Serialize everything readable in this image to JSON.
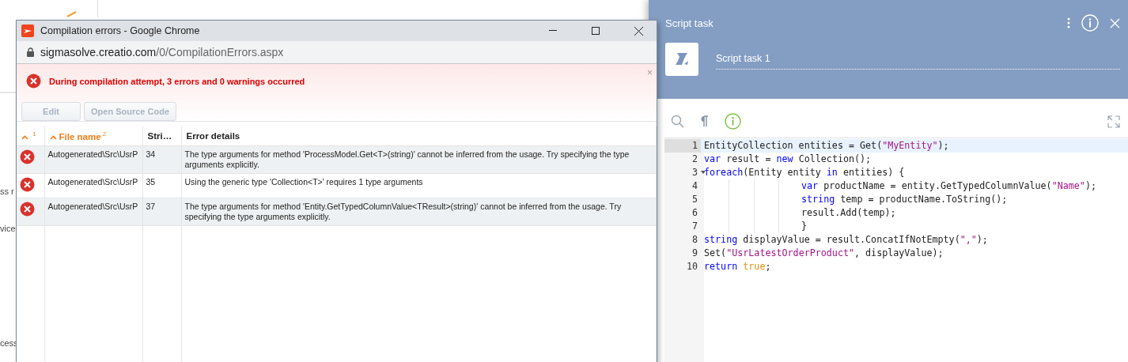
{
  "background_page": {
    "fragments": [
      "ss r",
      "vice",
      "cess"
    ]
  },
  "chrome_window": {
    "title": "Compilation errors - Google Chrome",
    "address": {
      "host": "sigmasolve.creatio.com",
      "path": "/0/CompilationErrors.aspx"
    },
    "banner": {
      "message": "During compilation attempt, 3 errors and 0 warnings occurred",
      "close": "×"
    },
    "buttons": [
      {
        "label": "Edit",
        "disabled": true
      },
      {
        "label": "Open Source Code",
        "disabled": true
      }
    ],
    "table": {
      "columns": [
        {
          "sort_order": "1",
          "sorted": true
        },
        {
          "label": "File name",
          "sort_order": "2",
          "sorted": true
        },
        {
          "label": "Stri…",
          "sorted": false
        },
        {
          "label": "Error details",
          "sorted": false
        }
      ],
      "rows": [
        {
          "kind": "error",
          "file": "Autogenerated\\Src\\UsrP",
          "line": "34",
          "details": "The type arguments for method 'ProcessModel.Get<T>(string)' cannot be inferred from the usage. Try specifying the type arguments explicitly."
        },
        {
          "kind": "error",
          "file": "Autogenerated\\Src\\UsrP",
          "line": "35",
          "details": "Using the generic type 'Collection<T>' requires 1 type arguments"
        },
        {
          "kind": "error",
          "file": "Autogenerated\\Src\\UsrP",
          "line": "37",
          "details": "The type arguments for method 'Entity.GetTypedColumnValue<TResult>(string)' cannot be inferred from the usage. Try specifying the type arguments explicitly."
        }
      ]
    }
  },
  "script_panel": {
    "title": "Script task",
    "name": "Script task 1",
    "editor": {
      "lines": [
        {
          "number": "1",
          "selected": true,
          "tokens": [
            {
              "kind": "plain",
              "text": "EntityCollection entities = Get("
            },
            {
              "kind": "string",
              "text": "\"MyEntity\""
            },
            {
              "kind": "plain",
              "text": ");"
            }
          ]
        },
        {
          "number": "2",
          "selected": false,
          "tokens": [
            {
              "kind": "keyword",
              "text": "var"
            },
            {
              "kind": "plain",
              "text": " result = "
            },
            {
              "kind": "keyword",
              "text": "new"
            },
            {
              "kind": "plain",
              "text": " Collection();"
            }
          ]
        },
        {
          "number": "3",
          "selected": false,
          "expanded": true,
          "tokens": [
            {
              "kind": "keyword",
              "text": "foreach"
            },
            {
              "kind": "plain",
              "text": "(Entity entity "
            },
            {
              "kind": "keyword",
              "text": "in"
            },
            {
              "kind": "plain",
              "text": " entities) {"
            }
          ],
          "children": [
            {
              "number": "4",
              "selected": false,
              "tokens": [
                {
                  "kind": "keyword",
                  "text": "var"
                },
                {
                  "kind": "plain",
                  "text": " productName = entity.GetTypedColumnValue("
                },
                {
                  "kind": "string",
                  "text": "\"Name\""
                },
                {
                  "kind": "plain",
                  "text": ");"
                }
              ]
            },
            {
              "number": "5",
              "selected": false,
              "tokens": [
                {
                  "kind": "keyword",
                  "text": "string"
                },
                {
                  "kind": "plain",
                  "text": " temp = productName.ToString();"
                }
              ]
            },
            {
              "number": "6",
              "selected": false,
              "tokens": [
                {
                  "kind": "plain",
                  "text": "result.Add(temp);"
                }
              ]
            },
            {
              "number": "7",
              "selected": false,
              "tokens": [
                {
                  "kind": "plain",
                  "text": "}"
                }
              ]
            }
          ]
        },
        {
          "number": "8",
          "selected": false,
          "tokens": [
            {
              "kind": "keyword",
              "text": "string"
            },
            {
              "kind": "plain",
              "text": " displayValue = result.ConcatIfNotEmpty("
            },
            {
              "kind": "string",
              "text": "\",\""
            },
            {
              "kind": "plain",
              "text": ");"
            }
          ]
        },
        {
          "number": "9",
          "selected": false,
          "tokens": [
            {
              "kind": "plain",
              "text": "Set("
            },
            {
              "kind": "string",
              "text": "\"UsrLatestOrderProduct\""
            },
            {
              "kind": "plain",
              "text": ", displayValue);"
            }
          ]
        },
        {
          "number": "10",
          "selected": false,
          "tokens": [
            {
              "kind": "keyword",
              "text": "return "
            },
            {
              "kind": "literal",
              "text": "true"
            },
            {
              "kind": "plain",
              "text": ";"
            }
          ]
        }
      ]
    }
  }
}
